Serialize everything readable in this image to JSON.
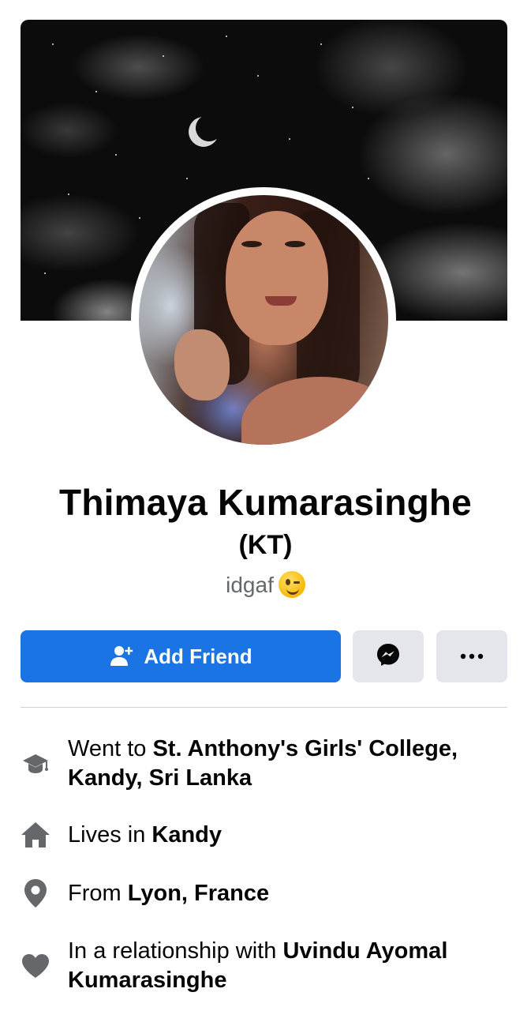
{
  "profile": {
    "name": "Thimaya Kumarasinghe",
    "alternate_name": "(KT)",
    "bio_text": "idgaf",
    "bio_emoji": "winking-face-emoji"
  },
  "actions": {
    "add_friend_label": "Add Friend",
    "add_friend_icon": "add-person-icon",
    "message_icon": "messenger-icon",
    "more_icon": "more-options-icon"
  },
  "details": {
    "education": {
      "icon": "graduation-cap-icon",
      "prefix": "Went to ",
      "value": "St. Anthony's Girls' College, Kandy, Sri Lanka"
    },
    "lives": {
      "icon": "home-icon",
      "prefix": "Lives in ",
      "value": "Kandy"
    },
    "from": {
      "icon": "location-pin-icon",
      "prefix": "From ",
      "value": "Lyon, France"
    },
    "relationship": {
      "icon": "heart-icon",
      "prefix": "In a relationship with ",
      "value": "Uvindu Ayomal Kumarasinghe"
    }
  },
  "colors": {
    "primary_button": "#1b74e4",
    "secondary_button": "#e4e6eb",
    "icon_grey": "#65676b",
    "text": "#050505"
  }
}
